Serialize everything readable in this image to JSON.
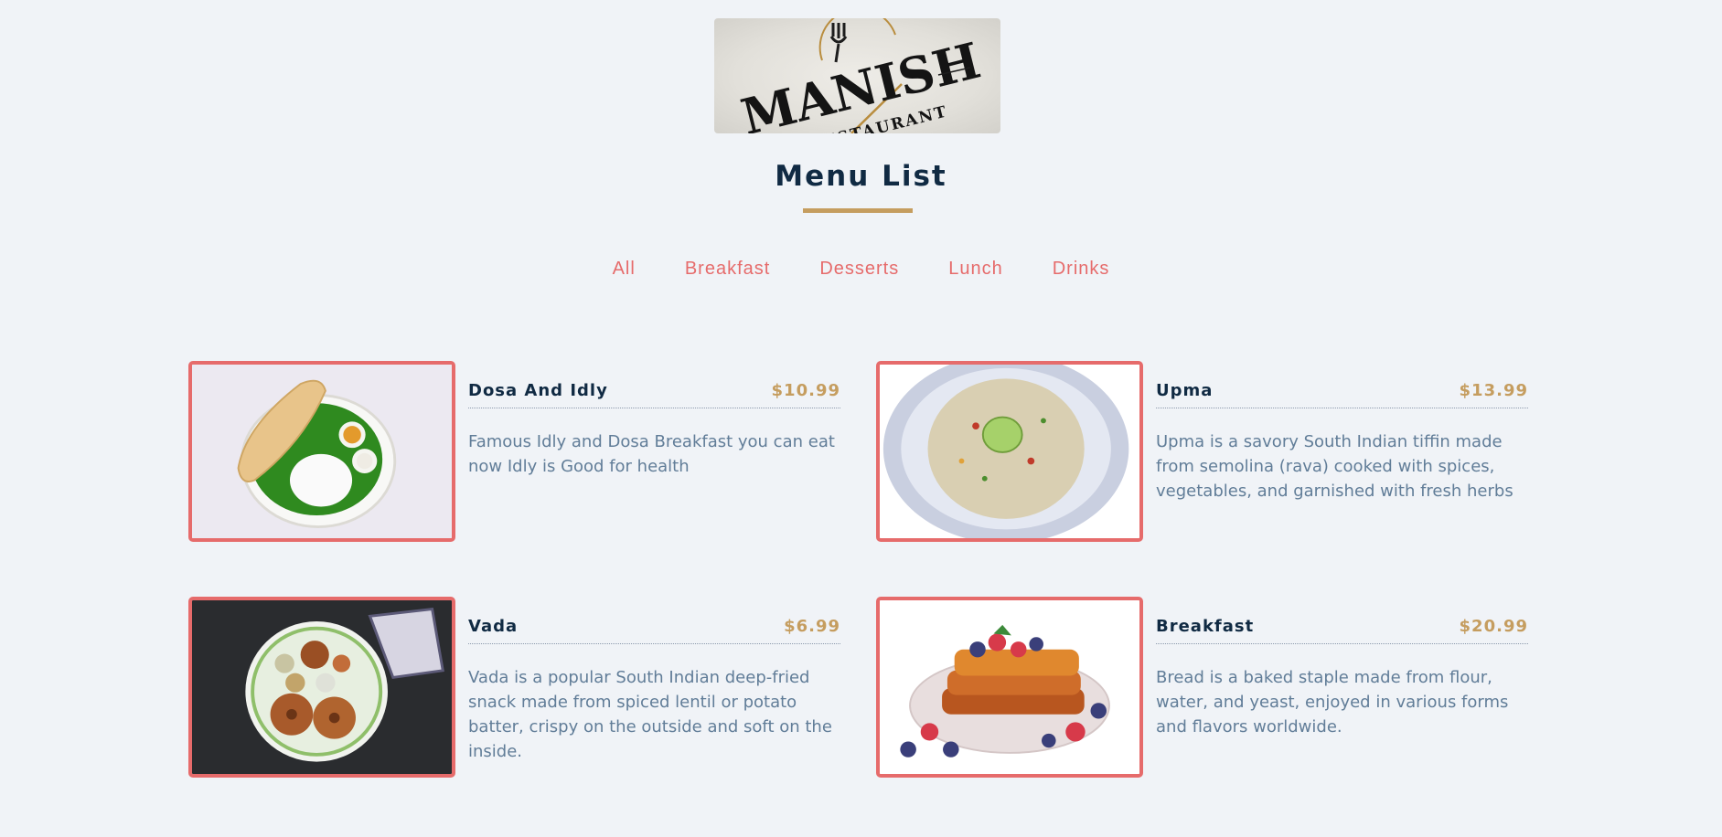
{
  "logo": {
    "text": "MANISH",
    "subtitle": "RESTAURANT",
    "icon": "fork-logo-icon"
  },
  "page": {
    "title": "Menu List"
  },
  "filters": [
    "All",
    "Breakfast",
    "Desserts",
    "Lunch",
    "Drinks"
  ],
  "colors": {
    "accent": "#e66b6b",
    "gold": "#c59d5f",
    "heading": "#102a43",
    "text": "#617d98",
    "background": "#f0f3f7"
  },
  "menu": [
    {
      "name": "Dosa And Idly",
      "price": "$10.99",
      "description": "Famous Idly and Dosa Breakfast you can eat now Idly is Good for health"
    },
    {
      "name": "Upma",
      "price": "$13.99",
      "description": "Upma is a savory South Indian tiffin made from semolina (rava) cooked with spices, vegetables, and garnished with fresh herbs"
    },
    {
      "name": "Vada",
      "price": "$6.99",
      "description": "Vada is a popular South Indian deep-fried snack made from spiced lentil or potato batter, crispy on the outside and soft on the inside."
    },
    {
      "name": "Breakfast",
      "price": "$20.99",
      "description": "Bread is a baked staple made from flour, water, and yeast, enjoyed in various forms and flavors worldwide."
    }
  ]
}
